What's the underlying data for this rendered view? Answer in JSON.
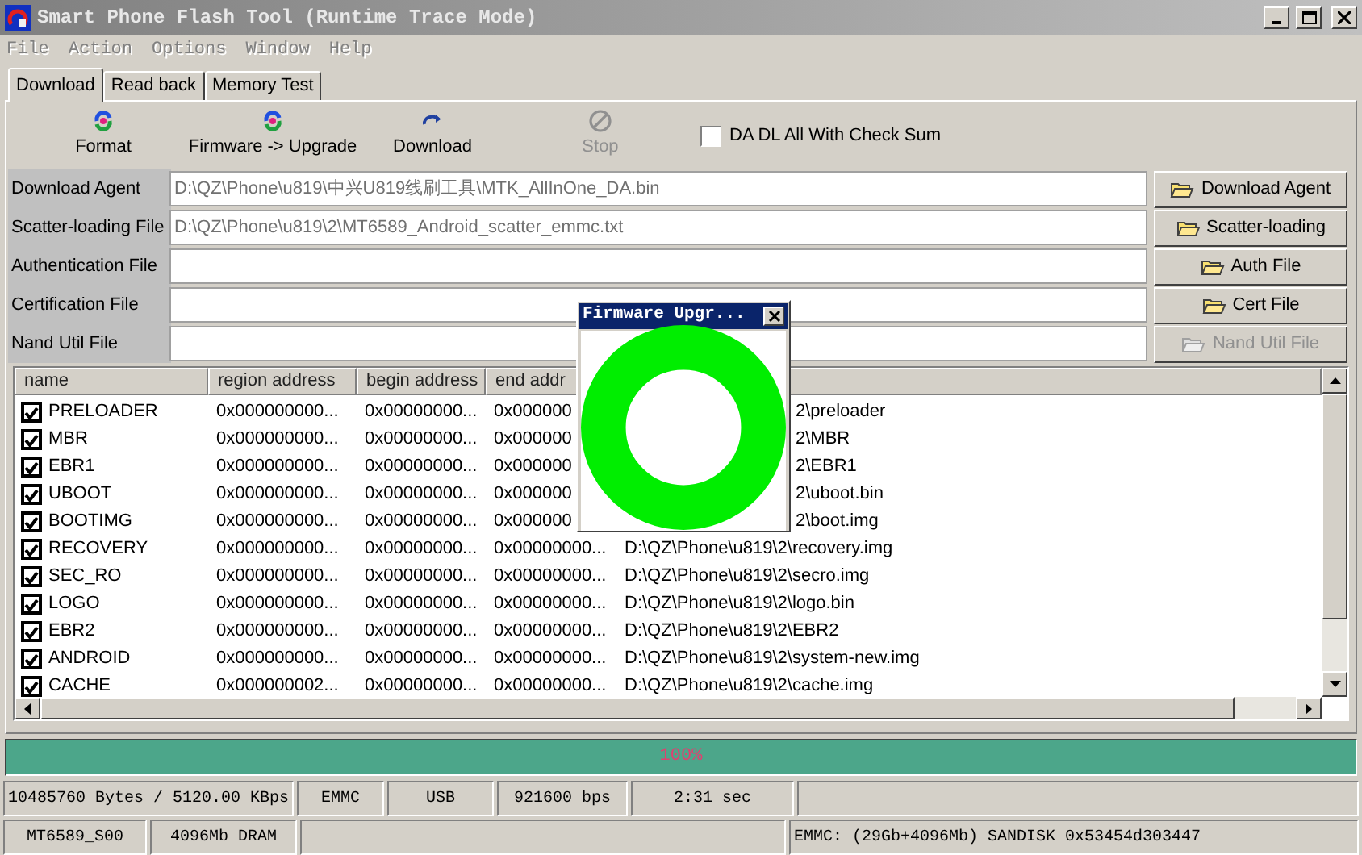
{
  "window": {
    "title": "Smart Phone Flash Tool (Runtime Trace Mode)"
  },
  "menu": [
    {
      "label": "File",
      "disabled": true
    },
    {
      "label": "Action",
      "disabled": true
    },
    {
      "label": "Options",
      "disabled": true
    },
    {
      "label": "Window",
      "disabled": true
    },
    {
      "label": "Help",
      "disabled": true
    }
  ],
  "tabs": [
    {
      "label": "Download",
      "selected": true
    },
    {
      "label": "Read back",
      "selected": false
    },
    {
      "label": "Memory Test",
      "selected": false
    }
  ],
  "toolbar": [
    {
      "label": "Format",
      "kind": "format",
      "disabled": false
    },
    {
      "label": "Firmware -> Upgrade",
      "kind": "format",
      "disabled": false
    },
    {
      "label": "Download",
      "kind": "download",
      "disabled": false
    },
    {
      "label": "Stop",
      "kind": "stop",
      "disabled": true
    }
  ],
  "checksum_option": {
    "label": "DA DL All With Check Sum",
    "checked": false
  },
  "files": [
    {
      "label": "Download Agent",
      "value": "D:\\QZ\\Phone\\u819\\中兴U819线刷工具\\MTK_AllInOne_DA.bin",
      "button": "Download Agent",
      "disabled": false
    },
    {
      "label": "Scatter-loading File",
      "value": "D:\\QZ\\Phone\\u819\\2\\MT6589_Android_scatter_emmc.txt",
      "button": "Scatter-loading",
      "disabled": false
    },
    {
      "label": "Authentication File",
      "button": "Auth File",
      "disabled": false
    },
    {
      "label": "Certification File",
      "button": "Cert File",
      "disabled": false
    },
    {
      "label": "Nand Util File",
      "button": "Nand Util File",
      "disabled": true
    }
  ],
  "table": {
    "columns": [
      "name",
      "region address",
      "begin address",
      "end addr"
    ],
    "rows": [
      {
        "checked": true,
        "name": "PRELOADER",
        "region": "0x000000000...",
        "begin": "0x00000000...",
        "end": "0x000000",
        "location": "2\\preloader",
        "covered": true
      },
      {
        "checked": true,
        "name": "MBR",
        "region": "0x000000000...",
        "begin": "0x00000000...",
        "end": "0x000000",
        "location": "2\\MBR",
        "covered": true
      },
      {
        "checked": true,
        "name": "EBR1",
        "region": "0x000000000...",
        "begin": "0x00000000...",
        "end": "0x000000",
        "location": "2\\EBR1",
        "covered": true
      },
      {
        "checked": true,
        "name": "UBOOT",
        "region": "0x000000000...",
        "begin": "0x00000000...",
        "end": "0x000000",
        "location": "2\\uboot.bin",
        "covered": true
      },
      {
        "checked": true,
        "name": "BOOTIMG",
        "region": "0x000000000...",
        "begin": "0x00000000...",
        "end": "0x000000",
        "location": "2\\boot.img",
        "covered": true
      },
      {
        "checked": true,
        "name": "RECOVERY",
        "region": "0x000000000...",
        "begin": "0x00000000...",
        "end": "0x00000000...",
        "location": "D:\\QZ\\Phone\\u819\\2\\recovery.img",
        "covered": false
      },
      {
        "checked": true,
        "name": "SEC_RO",
        "region": "0x000000000...",
        "begin": "0x00000000...",
        "end": "0x00000000...",
        "location": "D:\\QZ\\Phone\\u819\\2\\secro.img",
        "covered": false
      },
      {
        "checked": true,
        "name": "LOGO",
        "region": "0x000000000...",
        "begin": "0x00000000...",
        "end": "0x00000000...",
        "location": "D:\\QZ\\Phone\\u819\\2\\logo.bin",
        "covered": false
      },
      {
        "checked": true,
        "name": "EBR2",
        "region": "0x000000000...",
        "begin": "0x00000000...",
        "end": "0x00000000...",
        "location": "D:\\QZ\\Phone\\u819\\2\\EBR2",
        "covered": false
      },
      {
        "checked": true,
        "name": "ANDROID",
        "region": "0x000000000...",
        "begin": "0x00000000...",
        "end": "0x00000000...",
        "location": "D:\\QZ\\Phone\\u819\\2\\system-new.img",
        "covered": false
      },
      {
        "checked": true,
        "name": "CACHE",
        "region": "0x000000002...",
        "begin": "0x00000000...",
        "end": "0x00000000...",
        "location": "D:\\QZ\\Phone\\u819\\2\\cache.img",
        "covered": false
      }
    ]
  },
  "progress": {
    "level": 1,
    "text": "100%"
  },
  "status_bar": [
    [
      {
        "kind": "text",
        "text": "10485760 Bytes / 5120.00 KBps"
      },
      {
        "kind": "text",
        "text": "EMMC"
      },
      {
        "kind": "text",
        "text": "USB"
      },
      {
        "kind": "text",
        "text": "921600 bps"
      },
      {
        "kind": "text",
        "text": "2:31 sec"
      },
      {
        "kind": "empty"
      }
    ],
    [
      {
        "kind": "text",
        "text": "MT6589_S00"
      },
      {
        "kind": "text",
        "text": "4096Mb DRAM"
      },
      {
        "kind": "empty"
      },
      {
        "kind": "text",
        "text": "EMMC: (29Gb+4096Mb) SANDISK 0x53454d303447"
      }
    ]
  ],
  "popup": {
    "title": "Firmware Upgr..."
  }
}
